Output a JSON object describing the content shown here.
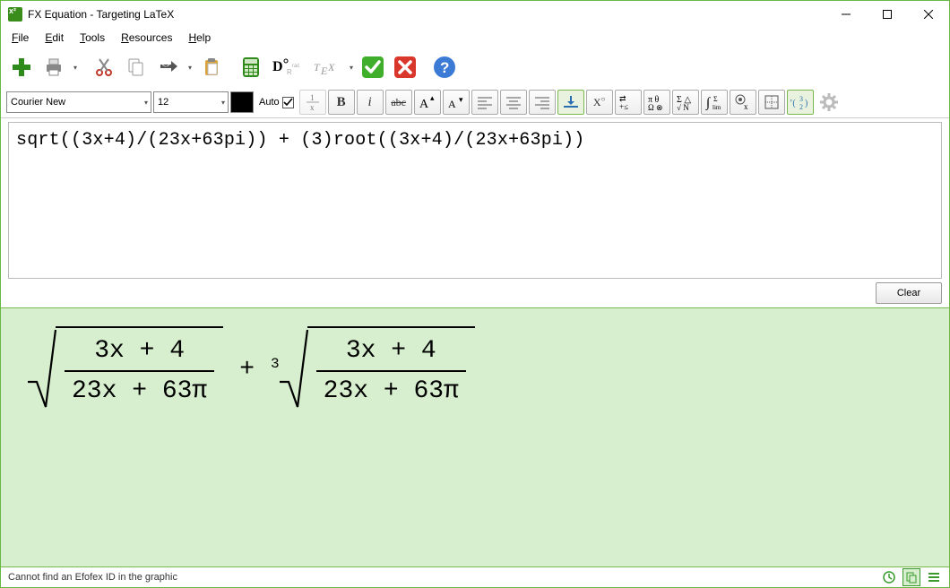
{
  "window": {
    "title": "FX Equation - Targeting LaTeX"
  },
  "menu": {
    "file": "File",
    "edit": "Edit",
    "tools": "Tools",
    "resources": "Resources",
    "help": "Help"
  },
  "font": {
    "name": "Courier New",
    "size": "12",
    "auto_label": "Auto",
    "auto_checked": true,
    "color": "#000000"
  },
  "input": {
    "code": "sqrt((3x+4)/(23x+63pi)) + (3)root((3x+4)/(23x+63pi))"
  },
  "buttons": {
    "clear": "Clear"
  },
  "status": {
    "text": "Cannot find an Efofex ID in the graphic"
  },
  "equation": {
    "term1": {
      "type": "sqrt",
      "num": "3x + 4",
      "den": "23x + 63π"
    },
    "op": "+",
    "term2": {
      "type": "root",
      "index": "3",
      "num": "3x + 4",
      "den": "23x + 63π"
    }
  },
  "icons": {
    "add": "add-icon",
    "print": "print-icon",
    "cut": "cut-icon",
    "copy": "copy-icon",
    "swap": "swap-icon",
    "paste": "paste-icon",
    "calc": "calculator-icon",
    "degrad": "degrees-radians-icon",
    "tex": "tex-icon",
    "accept": "accept-icon",
    "cancel": "cancel-icon",
    "help": "help-icon",
    "frac": "fraction-icon",
    "bold": "bold-icon",
    "italic": "italic-icon",
    "strike": "strikethrough-icon",
    "supers": "superscript-plus-icon",
    "subs": "superscript-minus-icon",
    "alignl": "align-left-icon",
    "alignc": "align-center-icon",
    "alignr": "align-right-icon",
    "alignb": "align-baseline-icon",
    "exp": "exponent-icon",
    "arrows": "arrows-icon",
    "greek": "greek-pi-theta-icon",
    "shapes": "sigma-triangle-icon",
    "integral": "integral-icon",
    "limits": "limits-icon",
    "target": "target-icon",
    "matrix": "matrix-icon",
    "binom": "binomial-icon",
    "gear": "gear-icon",
    "history": "history-icon",
    "copyout": "copy-output-icon",
    "menu": "hamburger-icon"
  }
}
